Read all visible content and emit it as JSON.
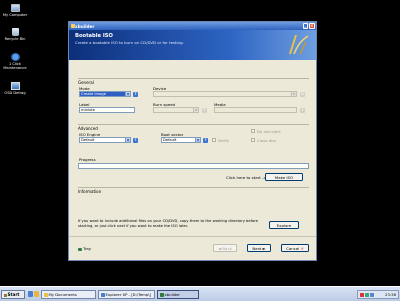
{
  "desktop": {
    "icons": [
      {
        "label": "My Computer",
        "icon": "computer-icon"
      },
      {
        "label": "Recycle Bin",
        "icon": "recycle-bin-icon"
      },
      {
        "label": "1 Click Maintenance",
        "icon": "maintenance-icon"
      },
      {
        "label": "OSD Defrag",
        "icon": "defrag-icon"
      }
    ]
  },
  "window": {
    "title": "xbuilder",
    "banner_title": "Bootable ISO",
    "banner_subtitle": "Create a bootable ISO to burn on CD/DVD or for testing.",
    "general": {
      "title": "General",
      "mode_label": "Mode",
      "mode_value": "Create Image",
      "device_label": "Device",
      "device_value": "",
      "label_label": "Label",
      "label_value": "minixte",
      "burn_speed_label": "Burn speed",
      "burn_speed_value": "",
      "media_label": "Media",
      "media_value": ""
    },
    "advanced": {
      "title": "Advanced",
      "iso_engine_label": "ISO Engine",
      "iso_engine_value": "Default",
      "boot_sector_label": "Boot sector",
      "boot_sector_value": "Default",
      "verify_label": "Verify",
      "do_not_eject_label": "Do not eject",
      "close_disc_label": "Close disc"
    },
    "progress": {
      "title": "Progress",
      "hint": "Click here to start ->",
      "make_iso_label": "Make ISO"
    },
    "information": {
      "title": "Information",
      "text": "If you want to include additional files on your CD/DVD, copy them to the working directory before starting, or just click next if you want to make the ISO later.",
      "explore_label": "Explore"
    },
    "footer": {
      "tray_label": "Tray",
      "back_label": "Back",
      "next_label": "Next",
      "cancel_label": "Cancel"
    }
  },
  "taskbar": {
    "start_label": "Start",
    "tasks": [
      {
        "label": "My Documents"
      },
      {
        "label": "Explorer XP - [D:\\Temp\\]"
      },
      {
        "label": "xbuilder"
      }
    ],
    "clock": "23:38"
  },
  "colors": {
    "desktop": "#000000",
    "banner": "#2d64c3",
    "titlebar": "#2f63c0",
    "window_face": "#ece9d8"
  }
}
